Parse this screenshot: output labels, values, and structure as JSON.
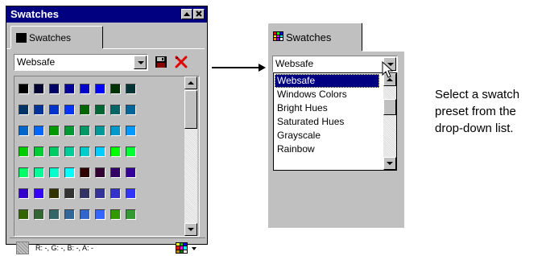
{
  "panel": {
    "title": "Swatches",
    "tab_label": "Swatches",
    "preset_value": "Websafe",
    "rgba_readout": "R: -, G: -, B: -, A: -",
    "icons": {
      "save": "floppy-disk-icon",
      "delete": "red-x-icon",
      "menu": "swatch-menu-icon",
      "minimize": "minimize-icon",
      "close": "close-icon"
    },
    "swatch_rows": [
      [
        "#000000",
        "#000033",
        "#000066",
        "#000099",
        "#0000cc",
        "#0000ff",
        "#003300",
        "#003333"
      ],
      [
        "#003366",
        "#003399",
        "#0033cc",
        "#0033ff",
        "#006600",
        "#006633",
        "#006666",
        "#006699"
      ],
      [
        "#0066cc",
        "#0066ff",
        "#009900",
        "#009933",
        "#009966",
        "#009999",
        "#0099cc",
        "#0099ff"
      ],
      [
        "#00cc00",
        "#00cc33",
        "#00cc66",
        "#00cc99",
        "#00cccc",
        "#00ccff",
        "#00ff00",
        "#00ff33"
      ],
      [
        "#00ff66",
        "#00ff99",
        "#00ffcc",
        "#00ffff",
        "#330000",
        "#330033",
        "#330066",
        "#330099"
      ],
      [
        "#3300cc",
        "#3300ff",
        "#333300",
        "#333333",
        "#333366",
        "#333399",
        "#3333cc",
        "#3333ff"
      ],
      [
        "#336600",
        "#336633",
        "#336666",
        "#336699",
        "#3366cc",
        "#3366ff",
        "#339900",
        "#339933"
      ]
    ]
  },
  "zoom": {
    "tab_label": "Swatches",
    "preset_value": "Websafe",
    "options": [
      "Websafe",
      "Windows Colors",
      "Bright Hues",
      "Saturated Hues",
      "Grayscale",
      "Rainbow"
    ],
    "selected_index": 0,
    "cursor": "mouse-pointer-icon"
  },
  "caption": {
    "line1": "Select a swatch",
    "line2": "preset from the",
    "line3": "drop-down list."
  },
  "colors": {
    "titlebar": "#000080",
    "selection": "#000080",
    "face": "#c0c0c0"
  }
}
